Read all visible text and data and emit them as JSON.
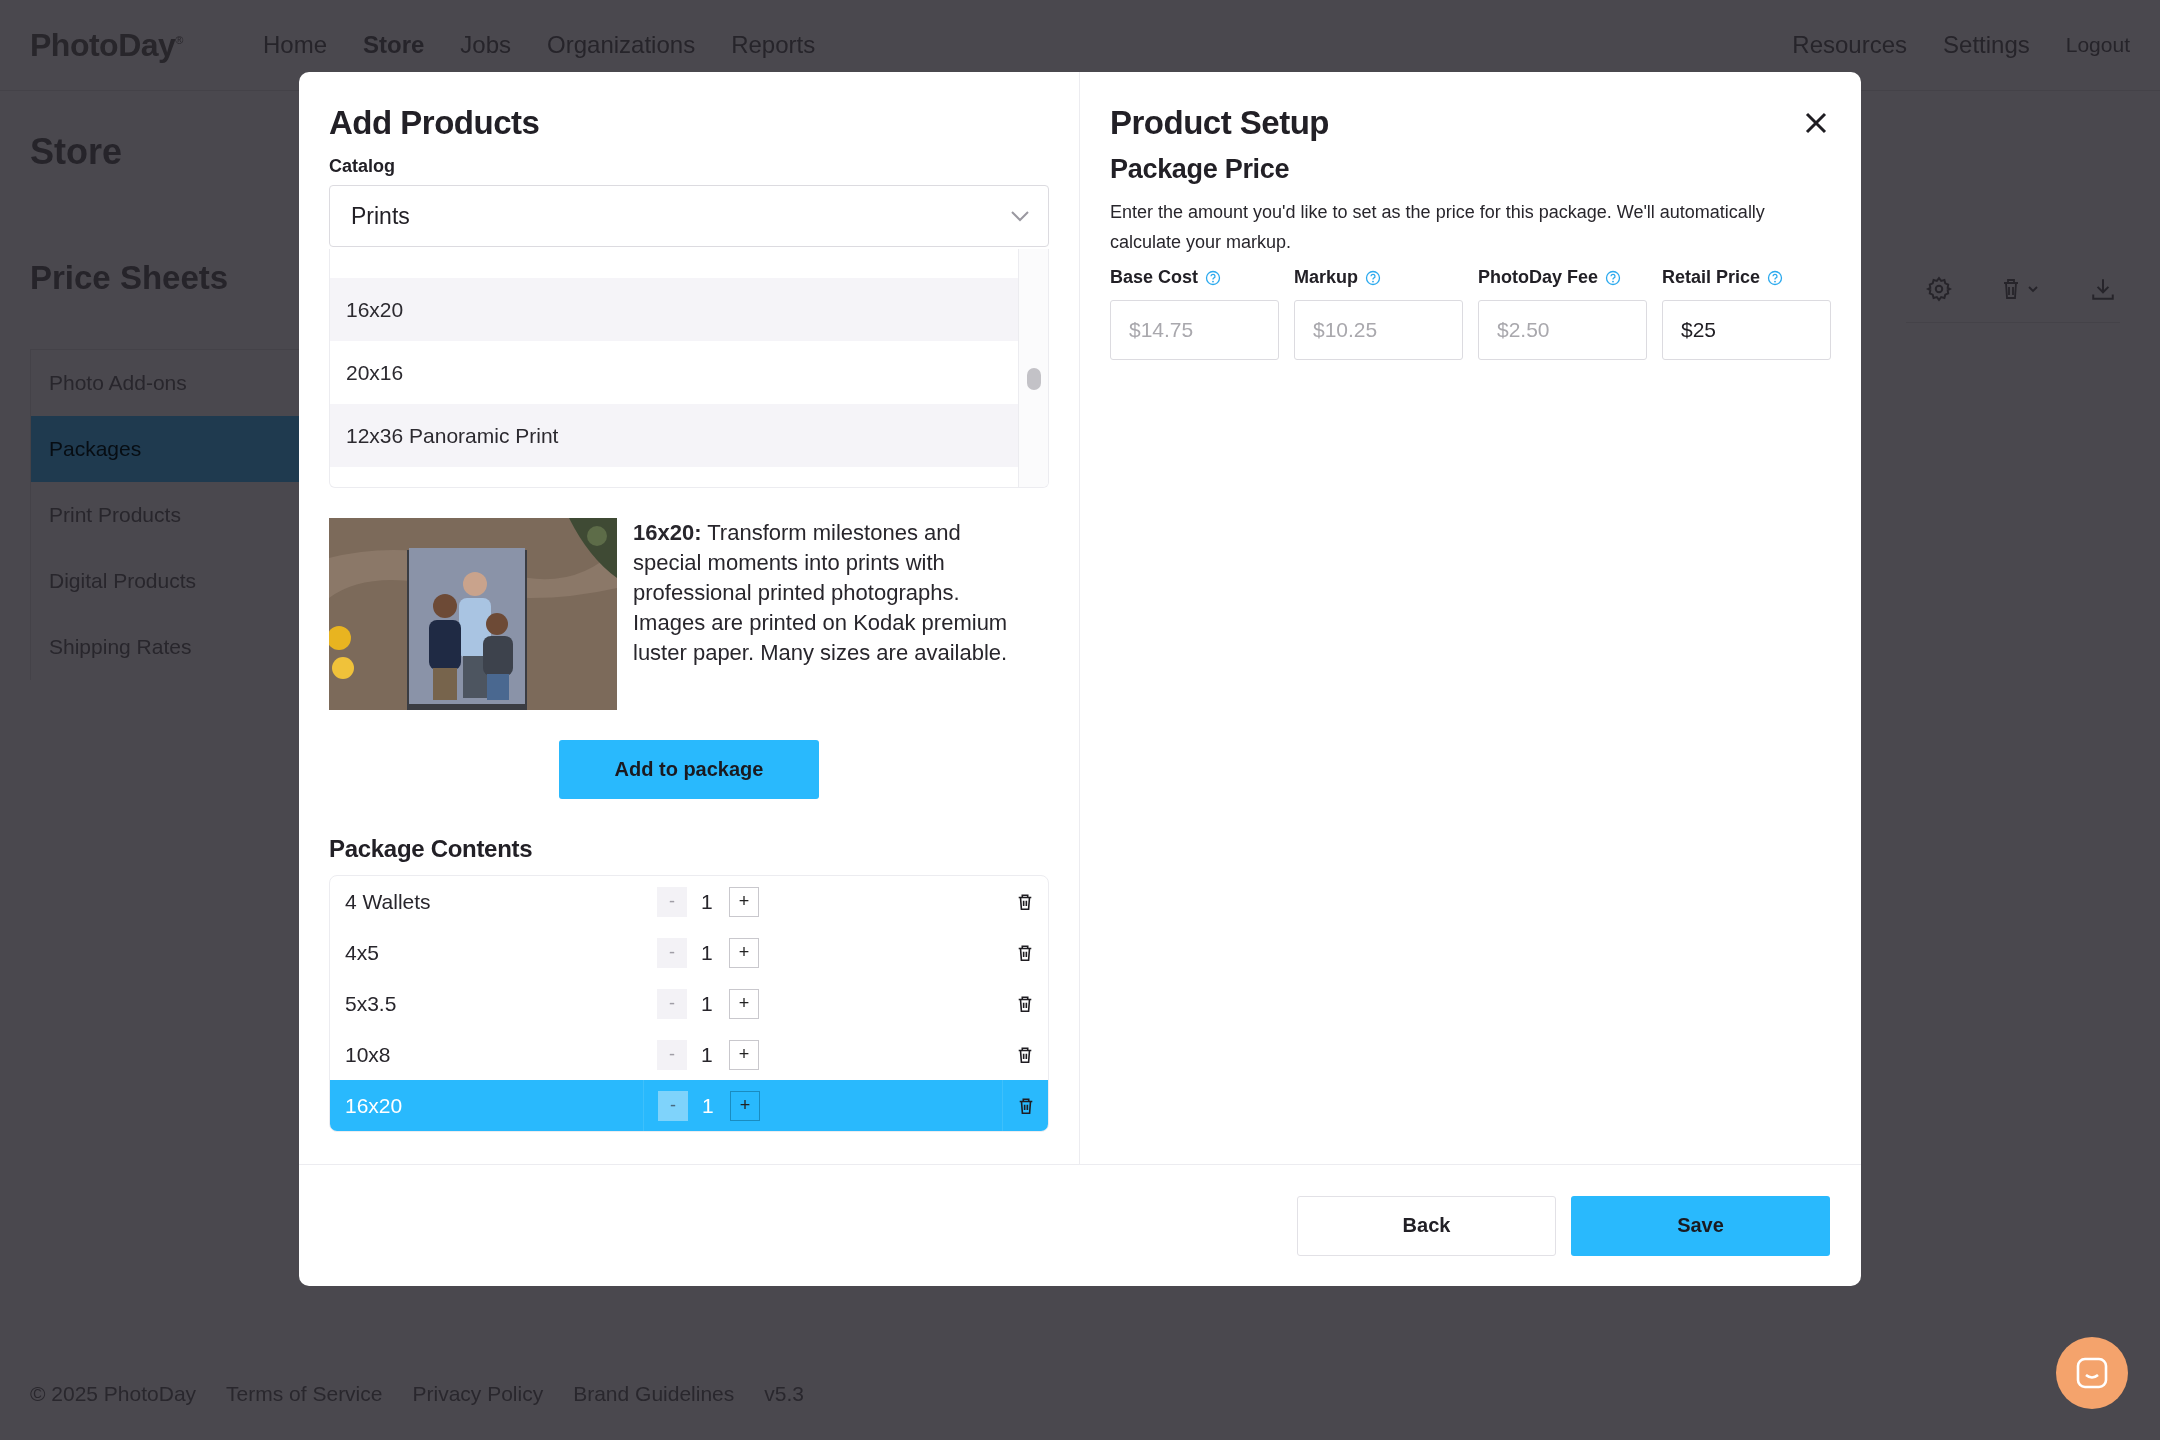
{
  "brand": {
    "logo": "PhotoDay$^{®}$"
  },
  "nav": {
    "left": [
      {
        "label": "Home",
        "selected": false
      },
      {
        "label": "Store",
        "selected": true
      },
      {
        "label": "Jobs",
        "selected": false
      },
      {
        "label": "Organizations",
        "selected": false
      },
      {
        "label": "Reports",
        "selected": false
      }
    ],
    "right": [
      {
        "label": "Resources"
      },
      {
        "label": "Settings"
      },
      {
        "label": "Logout"
      }
    ]
  },
  "page": {
    "title": "Store",
    "section_title": "Price Sheets",
    "sidebar": {
      "items": [
        {
          "label": "Photo Add-ons",
          "selected": false
        },
        {
          "label": "Packages",
          "selected": true
        },
        {
          "label": "Print Products",
          "selected": false
        },
        {
          "label": "Digital Products",
          "selected": false
        },
        {
          "label": "Shipping Rates",
          "selected": false
        }
      ]
    }
  },
  "modal": {
    "add_products": {
      "title": "Add Products",
      "catalog_label": "Catalog",
      "catalog": {
        "value": "Prints",
        "options": [
          {
            "label": "16x20"
          },
          {
            "label": "20x16"
          },
          {
            "label": "12x36 Panoramic Print"
          }
        ]
      },
      "product": {
        "description": "**16x20:** Transform milestones and special moments into prints with professional printed photographs. Images are printed on Kodak premium luster paper. Many sizes are available."
      },
      "add_button": "Add to package",
      "contents": {
        "title": "Package Contents",
        "rows": [
          {
            "name": "4 Wallets",
            "decrement": "-",
            "quantity": "1",
            "increment": "+",
            "selected": false
          },
          {
            "name": "4x5",
            "decrement": "-",
            "quantity": "1",
            "increment": "+",
            "selected": false
          },
          {
            "name": "5x3.5",
            "decrement": "-",
            "quantity": "1",
            "increment": "+",
            "selected": false
          },
          {
            "name": "10x8",
            "decrement": "-",
            "quantity": "1",
            "increment": "+",
            "selected": false
          },
          {
            "name": "16x20",
            "decrement": "-",
            "quantity": "1",
            "increment": "+",
            "selected": true
          }
        ]
      }
    },
    "product_setup": {
      "title": "Product Setup",
      "subtitle": "Package Price",
      "description": "Enter the amount you'd like to set as the price for this package. We'll automatically calculate your markup.",
      "fields": [
        {
          "label": "Base Cost",
          "value": "$14.75",
          "disabled": true
        },
        {
          "label": "Markup",
          "value": "$10.25",
          "disabled": true
        },
        {
          "label": "PhotoDay Fee",
          "value": "$2.50",
          "disabled": true
        },
        {
          "label": "Retail Price",
          "value": "$25",
          "disabled": false
        }
      ]
    },
    "buttons": [
      {
        "label": "Back",
        "kind": "secondary"
      },
      {
        "label": "Save",
        "kind": "primary"
      }
    ]
  },
  "footer": {
    "items": [
      {
        "label": "© 2025 PhotoDay"
      },
      {
        "label": "Terms of Service"
      },
      {
        "label": "Privacy Policy"
      },
      {
        "label": "Brand Guidelines"
      },
      {
        "label": "v5.3"
      }
    ]
  }
}
